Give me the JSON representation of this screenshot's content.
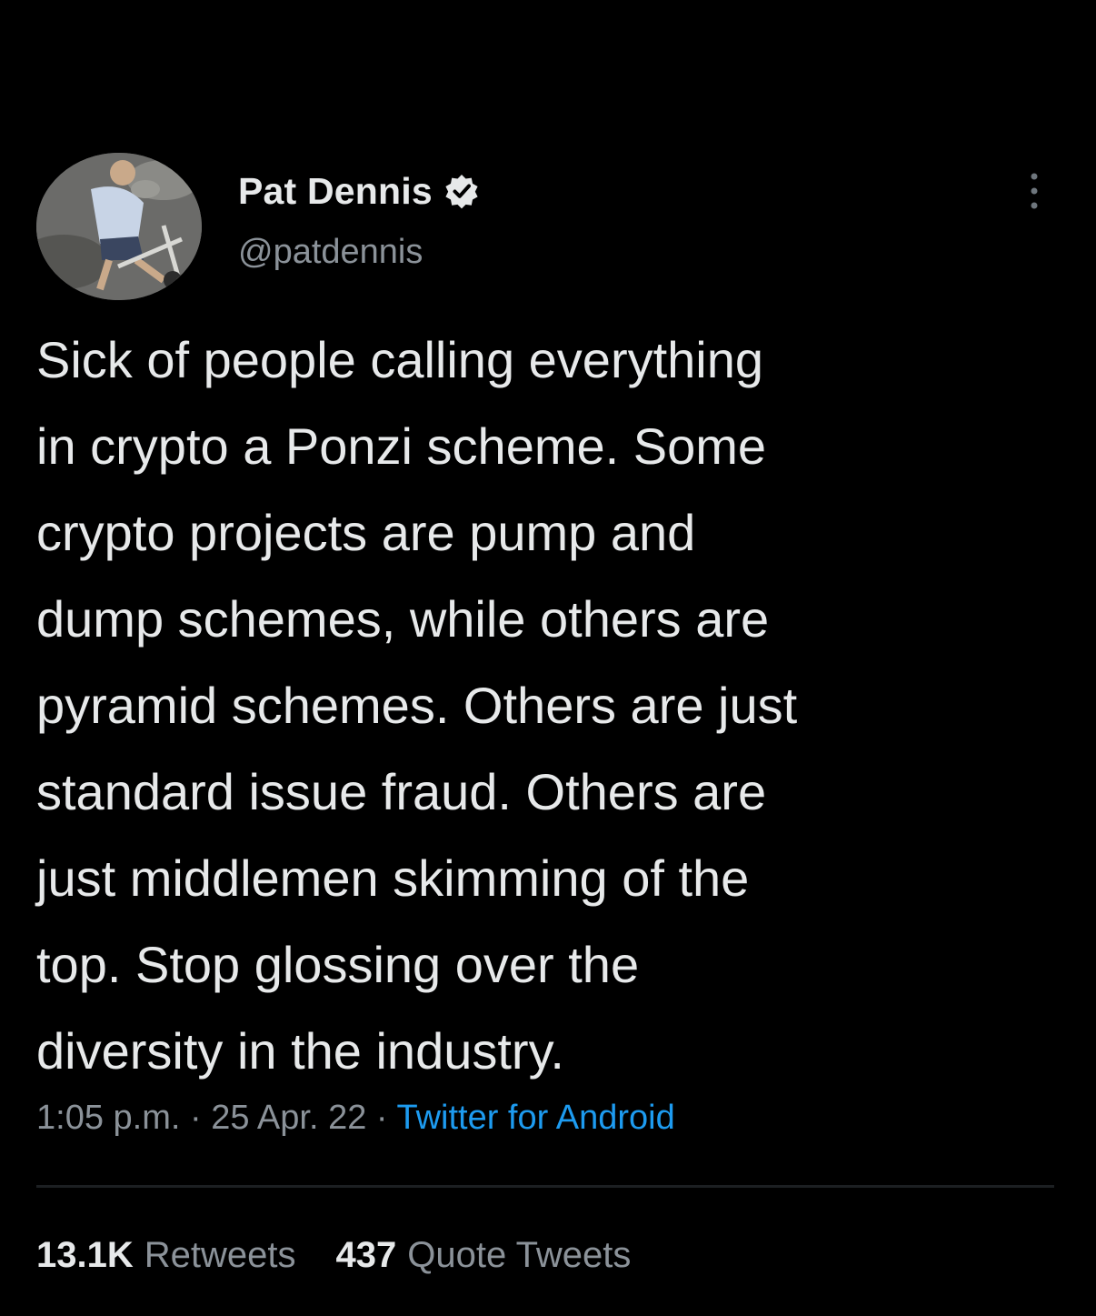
{
  "colors": {
    "background": "#000000",
    "text_primary": "#e7e9ea",
    "text_secondary": "#8b9299",
    "link": "#1d9bf0",
    "divider": "#1c1f22"
  },
  "tweet": {
    "author": {
      "display_name": "Pat Dennis",
      "handle": "@patdennis",
      "verified": true,
      "avatar_icon": "avatar-photo",
      "verified_icon": "verified-badge-icon"
    },
    "more_icon": "more-options-icon",
    "text": "Sick of people calling everything\nin crypto a Ponzi scheme. Some\ncrypto projects are pump and\ndump schemes, while others are\npyramid schemes. Others are just\nstandard issue fraud. Others are\njust middlemen skimming of the\ntop. Stop glossing over the\ndiversity in the industry.",
    "time": "1:05 p.m.",
    "date": "25 Apr. 22",
    "separator": "·",
    "source": "Twitter for Android"
  },
  "stats": {
    "retweets_count": "13.1K",
    "retweets_label": "Retweets",
    "quotes_count": "437",
    "quotes_label": "Quote Tweets"
  }
}
